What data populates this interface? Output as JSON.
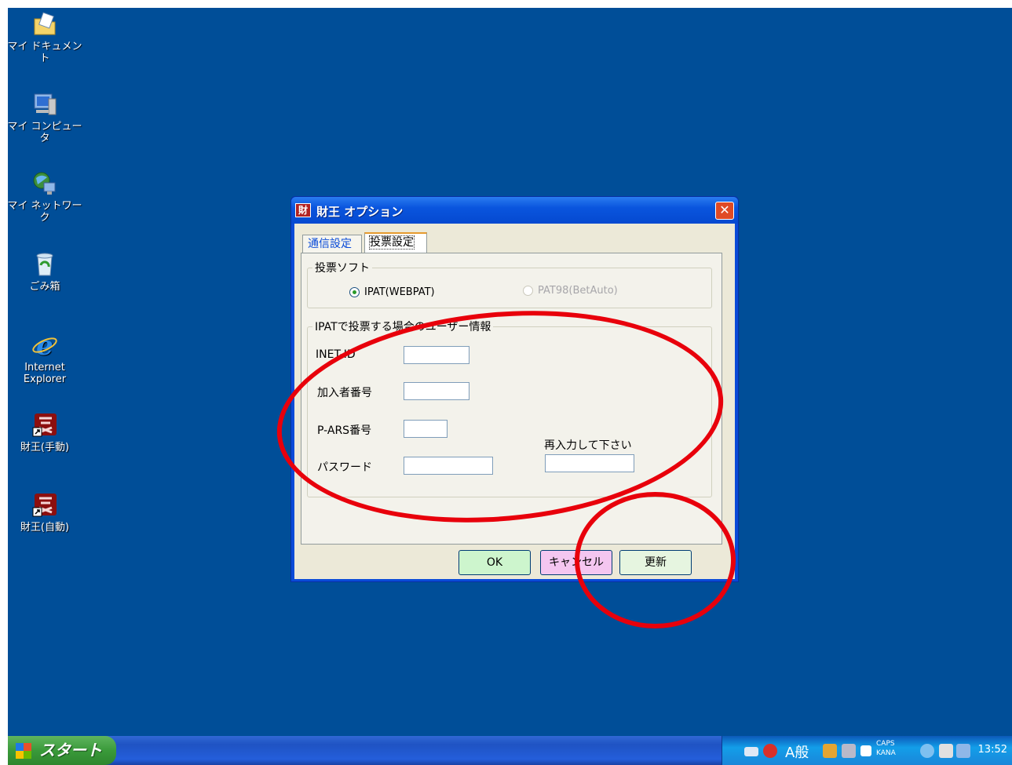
{
  "desktop": {
    "icons": [
      {
        "label": "マイ ドキュメント",
        "icon": "my-documents-icon"
      },
      {
        "label": "マイ コンピュータ",
        "icon": "my-computer-icon"
      },
      {
        "label": "マイ ネットワーク",
        "icon": "my-network-icon"
      },
      {
        "label": "ごみ箱",
        "icon": "recycle-bin-icon"
      },
      {
        "label": "Internet\nExplorer",
        "icon": "internet-explorer-icon"
      },
      {
        "label": "財王(手動)",
        "icon": "zaio-shortcut-icon"
      },
      {
        "label": "財王(自動)",
        "icon": "zaio-shortcut-icon"
      }
    ]
  },
  "dialog": {
    "title": "財王 オプション",
    "title_icon_text": "財",
    "close_glyph": "✕",
    "tabs": [
      {
        "label": "通信設定"
      },
      {
        "label": "投票設定",
        "selected": true
      }
    ],
    "vote_soft": {
      "legend": "投票ソフト",
      "options": [
        {
          "label": "IPAT(WEBPAT)",
          "checked": true,
          "enabled": true
        },
        {
          "label": "PAT98(BetAuto)",
          "checked": false,
          "enabled": false
        }
      ]
    },
    "user_info": {
      "legend": "IPATで投票する場合のユーザー情報",
      "fields": [
        {
          "label": "INET-ID",
          "value": ""
        },
        {
          "label": "加入者番号",
          "value": ""
        },
        {
          "label": "P-ARS番号",
          "value": ""
        },
        {
          "label": "パスワード",
          "value": ""
        }
      ],
      "reenter_label": "再入力して下さい",
      "reenter_value": ""
    },
    "buttons": {
      "ok": "OK",
      "cancel": "キャンセル",
      "update": "更新"
    }
  },
  "taskbar": {
    "start_label": "スタート",
    "ime_text": "A般",
    "caps_text": "CAPS\nKANA",
    "clock": "13:52"
  },
  "colors": {
    "desktop": "#004e98",
    "annotation": "#e8000b",
    "ok_button": "#cdf5cd",
    "cancel_button": "#f4c6f0"
  }
}
